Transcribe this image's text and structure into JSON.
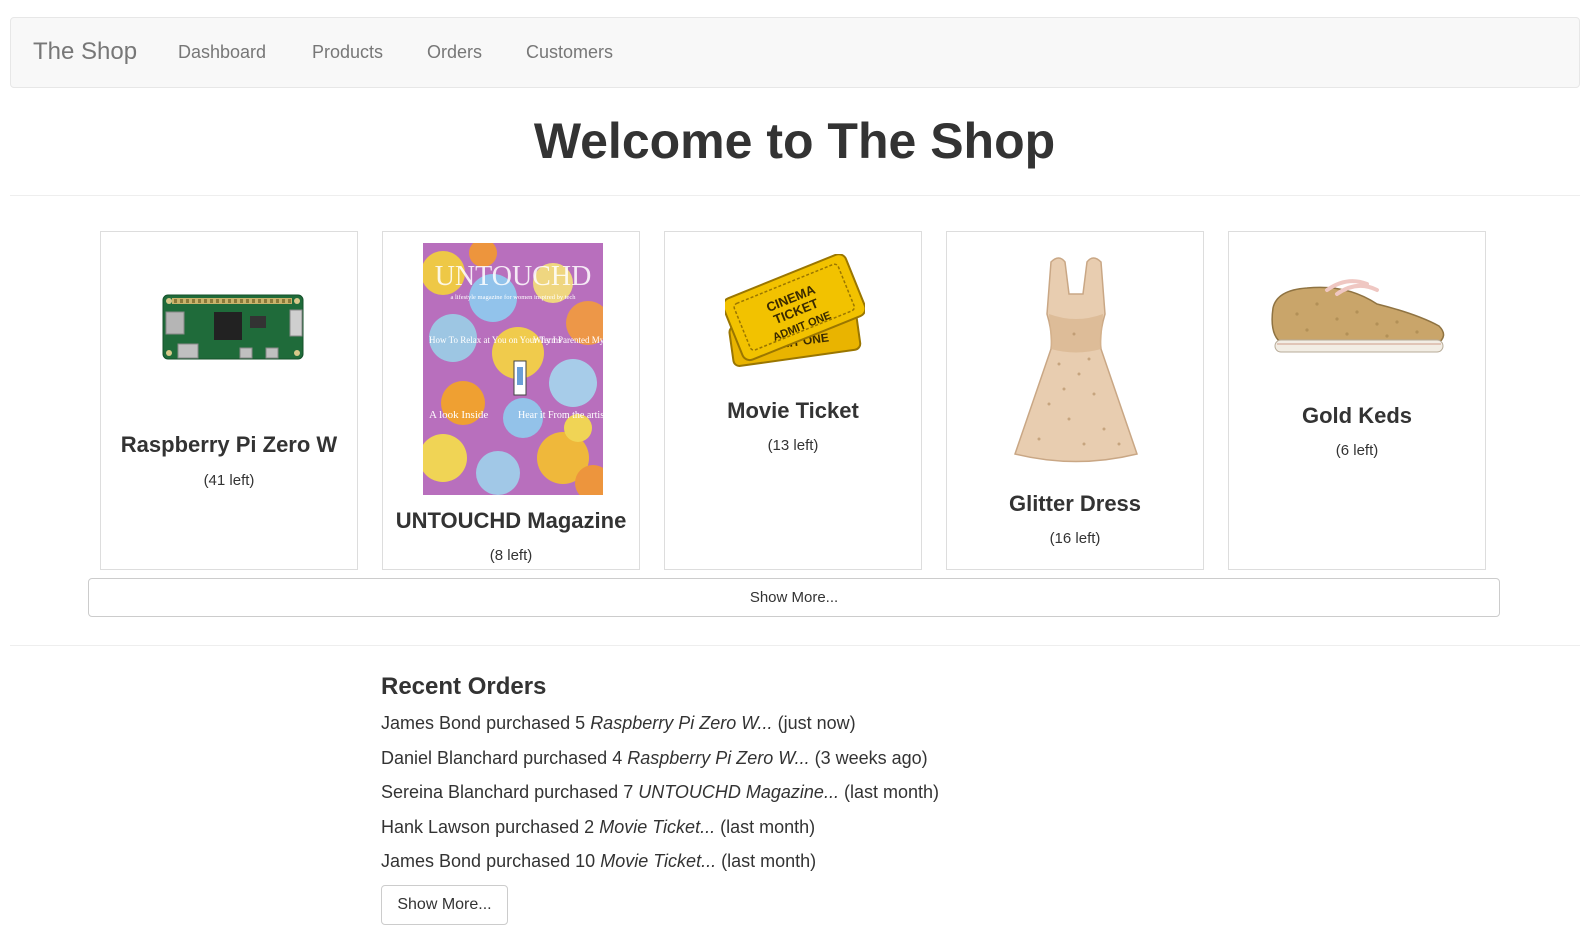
{
  "navbar": {
    "brand": "The Shop",
    "links": [
      "Dashboard",
      "Products",
      "Orders",
      "Customers"
    ]
  },
  "page_title": "Welcome to The Shop",
  "products": [
    {
      "name": "Raspberry Pi Zero W",
      "stock": "(41 left)",
      "image": "raspberry-pi-board"
    },
    {
      "name": "UNTOUCHD Magazine",
      "stock": "(8 left)",
      "image": "magazine-cover"
    },
    {
      "name": "Movie Ticket",
      "stock": "(13 left)",
      "image": "cinema-ticket"
    },
    {
      "name": "Glitter Dress",
      "stock": "(16 left)",
      "image": "glitter-dress"
    },
    {
      "name": "Gold Keds",
      "stock": "(6 left)",
      "image": "gold-sneaker"
    }
  ],
  "magazine_cover": {
    "masthead": "UNTOUCHD",
    "tagline": "a lifestyle magazine for women inspired by tech",
    "left_text": "How To Relax at You on Your Terms",
    "right_text": "Why I Parented My Creativity",
    "bottom_left": "A look Inside",
    "bottom_right": "Hear it From the artist"
  },
  "ticket": {
    "line1": "CINEMA",
    "line2": "TICKET",
    "line3": "ADMIT ONE",
    "back": "ADMIT ONE"
  },
  "products_show_more": "Show More...",
  "recent_orders": {
    "title": "Recent Orders",
    "items": [
      {
        "customer": "James Bond",
        "verb": "purchased",
        "qty": "5",
        "product": "Raspberry Pi Zero W...",
        "when": "(just now)"
      },
      {
        "customer": "Daniel Blanchard",
        "verb": "purchased",
        "qty": "4",
        "product": "Raspberry Pi Zero W...",
        "when": "(3 weeks ago)"
      },
      {
        "customer": "Sereina Blanchard",
        "verb": "purchased",
        "qty": "7",
        "product": "UNTOUCHD Magazine...",
        "when": "(last month)"
      },
      {
        "customer": "Hank Lawson",
        "verb": "purchased",
        "qty": "2",
        "product": "Movie Ticket...",
        "when": "(last month)"
      },
      {
        "customer": "James Bond",
        "verb": "purchased",
        "qty": "10",
        "product": "Movie Ticket...",
        "when": "(last month)"
      }
    ],
    "show_more": "Show More..."
  },
  "colors": {
    "navbar_bg": "#f8f8f8",
    "nav_text": "#777777",
    "text": "#333333",
    "border": "#dddddd",
    "ticket_gold": "#f2c200"
  }
}
